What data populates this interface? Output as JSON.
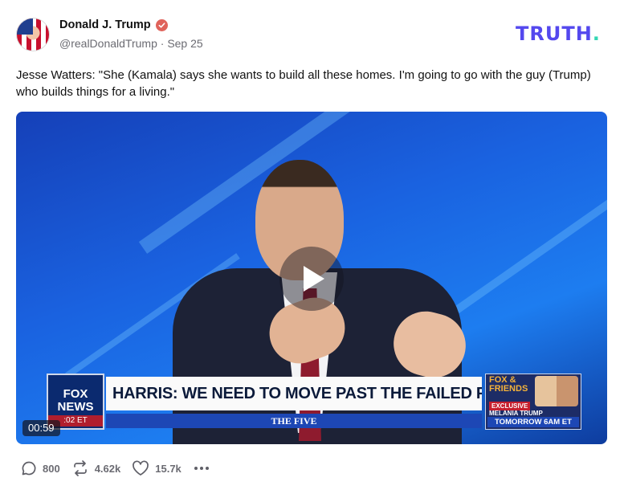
{
  "author": {
    "display_name": "Donald J. Trump",
    "handle": "@realDonaldTrump",
    "separator": " · ",
    "date": "Sep 25",
    "verified_color": "#e0635b"
  },
  "brand": {
    "logo_text": "TRUTH",
    "logo_dot": ".",
    "logo_color": "#5448ee",
    "dot_color": "#33d6b4"
  },
  "post": {
    "text": "Jesse Watters: \"She (Kamala) says she wants to build all these homes. I'm going to go with the guy (Trump) who builds things for a living.\""
  },
  "video": {
    "duration": "00:59",
    "chyron": {
      "network_logo": "FOX NEWS",
      "clock": ":02 ET",
      "headline": "HARRIS: WE NEED TO MOVE PAST THE FAILED POLICIES",
      "show_name": "THE FIVE",
      "promo_brand": "FOX & FRIENDS",
      "promo_tag": "EXCLUSIVE",
      "promo_sub": "MELANIA TRUMP",
      "promo_time": "TOMORROW 6AM ET"
    }
  },
  "actions": {
    "replies": "800",
    "retruths": "4.62k",
    "likes": "15.7k"
  }
}
